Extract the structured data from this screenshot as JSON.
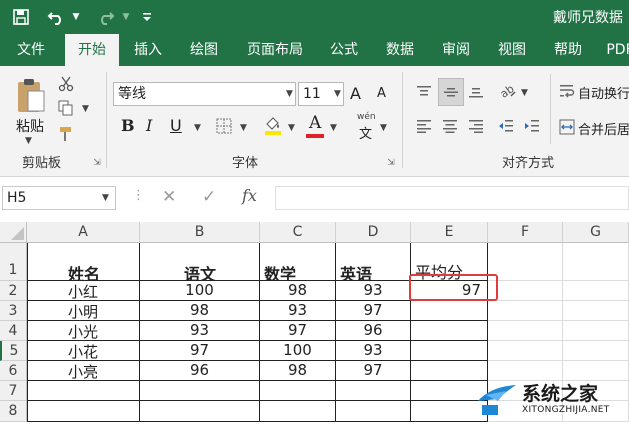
{
  "quick_access": {
    "save_icon": "save-icon",
    "undo_icon": "undo-icon",
    "redo_icon": "redo-icon",
    "customize_icon": "customize-icon"
  },
  "window": {
    "title": "戴师兄数据"
  },
  "tabs": [
    "文件",
    "开始",
    "插入",
    "绘图",
    "页面布局",
    "公式",
    "数据",
    "审阅",
    "视图",
    "帮助",
    "PDF"
  ],
  "active_tab": "开始",
  "ribbon": {
    "clipboard": {
      "paste_label": "粘贴",
      "group_label": "剪贴板"
    },
    "font": {
      "name": "等线",
      "size": "11",
      "bold": "B",
      "italic": "I",
      "underline": "U",
      "font_color": "A",
      "wen_label": "wén",
      "wen_char": "文",
      "group_label": "字体",
      "grow": "A",
      "shrink": "A"
    },
    "alignment": {
      "wrap_label": "自动换行",
      "merge_label": "合并后居",
      "group_label": "对齐方式"
    }
  },
  "formula_bar": {
    "name_box": "H5",
    "fx": "fx",
    "formula": ""
  },
  "columns": [
    "A",
    "B",
    "C",
    "D",
    "E",
    "F",
    "G"
  ],
  "rows": [
    "1",
    "2",
    "3",
    "4",
    "5",
    "6",
    "7",
    "8"
  ],
  "table": {
    "headers": [
      "姓名",
      "语文",
      "数学",
      "英语",
      "平均分"
    ],
    "data": [
      [
        "小红",
        "100",
        "98",
        "93",
        "97"
      ],
      [
        "小明",
        "98",
        "93",
        "97",
        ""
      ],
      [
        "小光",
        "93",
        "97",
        "96",
        ""
      ],
      [
        "小花",
        "97",
        "100",
        "93",
        ""
      ],
      [
        "小亮",
        "96",
        "98",
        "97",
        ""
      ]
    ]
  },
  "colors": {
    "accent": "#217346",
    "highlight": "#e23b3b",
    "font_color_bar": "#e0202a",
    "fill_color_bar": "#ffe600"
  },
  "watermark": {
    "title": "系统之家",
    "url": "XITONGZHIJIA.NET"
  }
}
